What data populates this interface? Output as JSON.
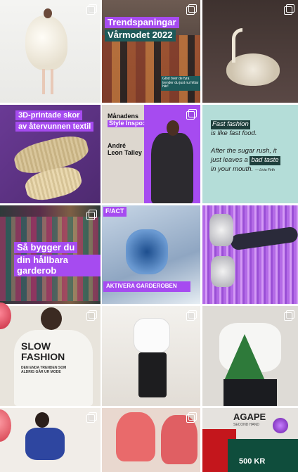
{
  "colors": {
    "accent_purple": "#a64bf0",
    "accent_teal": "#1e5a5a",
    "cream": "#f3efe4"
  },
  "tiles": {
    "t1": {
      "icon": "multiple-images-icon"
    },
    "t2": {
      "title_line1": "Trendspaningar",
      "title_line2": "Vårmodet 2022",
      "subtitle": "Glöd över de fyra trender du just nu hittar här!"
    },
    "t3": {
      "icon": "multiple-images-icon"
    },
    "t4": {
      "text_line1": "3D-printade skor",
      "text_line2": "av återvunnen textil"
    },
    "t5": {
      "heading_line1": "Månadens",
      "heading_line2": "Style Inspo:",
      "name_line1": "André",
      "name_line2": "Leon Talley"
    },
    "t6": {
      "line1": "Fast fashion",
      "line2": "is like fast food.",
      "line3": "After the sugar rush, it",
      "line4": "just leaves a",
      "line4_highlight": "bad taste",
      "line5": "in your mouth.",
      "attribution": "— Livia Firth"
    },
    "t7": {
      "line1": "Så bygger du",
      "line2": "din hållbara garderob"
    },
    "t8": {
      "logo": "F/ACT",
      "banner": "AKTIVERA GARDEROBEN"
    },
    "t10": {
      "shirt_line1": "SLOW",
      "shirt_line2": "FASHION",
      "shirt_small": "DEN ENDA TRENDEN SOM ALDRIG GÅR UR MODE"
    },
    "t15": {
      "line1": "AGAPE",
      "line2": "SECOND HAND",
      "price": "500 KR"
    }
  }
}
